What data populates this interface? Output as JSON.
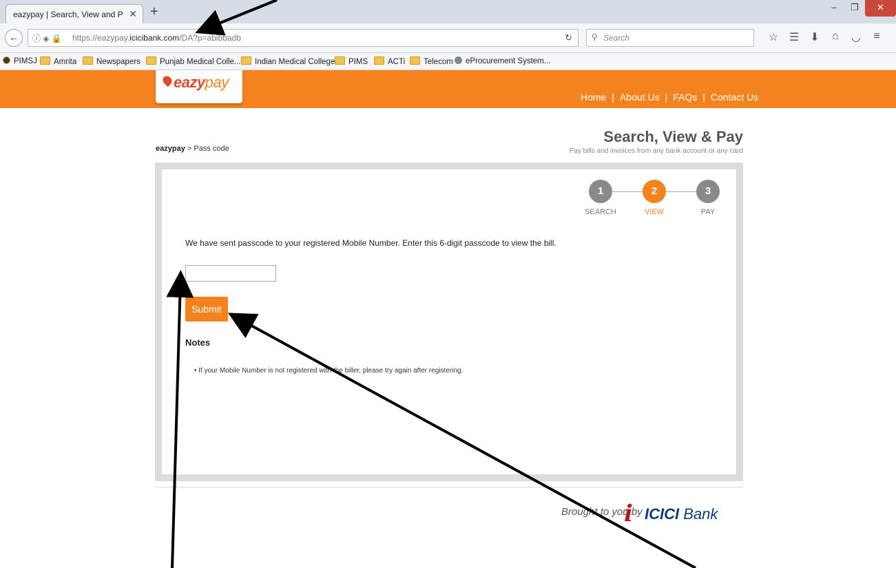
{
  "browser": {
    "tab_title": "eazypay | Search, View and Pay y",
    "tab_close": "✕",
    "new_tab": "+",
    "url_prefix": "https://eazypay.",
    "url_domain": "icicibank.com",
    "url_path": "/DA?p=abibbadb",
    "search_placeholder": "Search",
    "bookmarks": [
      "PIMSJ",
      "Amrita",
      "Newspapers",
      "Punjab Medical Colle...",
      "Indian Medical Colleges",
      "PIMS",
      "ACTi",
      "Telecom",
      "eProcurement System..."
    ]
  },
  "site": {
    "logo_strong": "eazy",
    "logo_light": "pay",
    "nav": [
      "Home",
      "About Us",
      "FAQs",
      "Contact Us"
    ],
    "nav_separator": "|"
  },
  "breadcrumb": {
    "root": "eazypay",
    "sep": ">",
    "current": "Pass code"
  },
  "page": {
    "title": "Search, View & Pay",
    "subtitle": "Pay bills and invoices from any bank account or any card"
  },
  "steps": [
    {
      "number": "1",
      "label": "SEARCH",
      "active": false
    },
    {
      "number": "2",
      "label": "VIEW",
      "active": true
    },
    {
      "number": "3",
      "label": "PAY",
      "active": false
    }
  ],
  "form": {
    "message": "We have sent passcode to your registered Mobile Number. Enter this 6-digit passcode to view the bill.",
    "passcode_value": "",
    "submit_label": "Submit"
  },
  "notes": {
    "title": "Notes",
    "items": [
      "If your Mobile Number is not registered with the biller, please try again after registering."
    ]
  },
  "footer": {
    "brought_by": "Brought to you by",
    "bank_mark": "i",
    "bank_strong": "ICICI",
    "bank_light": " Bank"
  },
  "colors": {
    "brand_orange": "#f4821f",
    "step_inactive": "#8a8a8a",
    "icici_red": "#b5191f",
    "icici_blue": "#0f3b79"
  }
}
